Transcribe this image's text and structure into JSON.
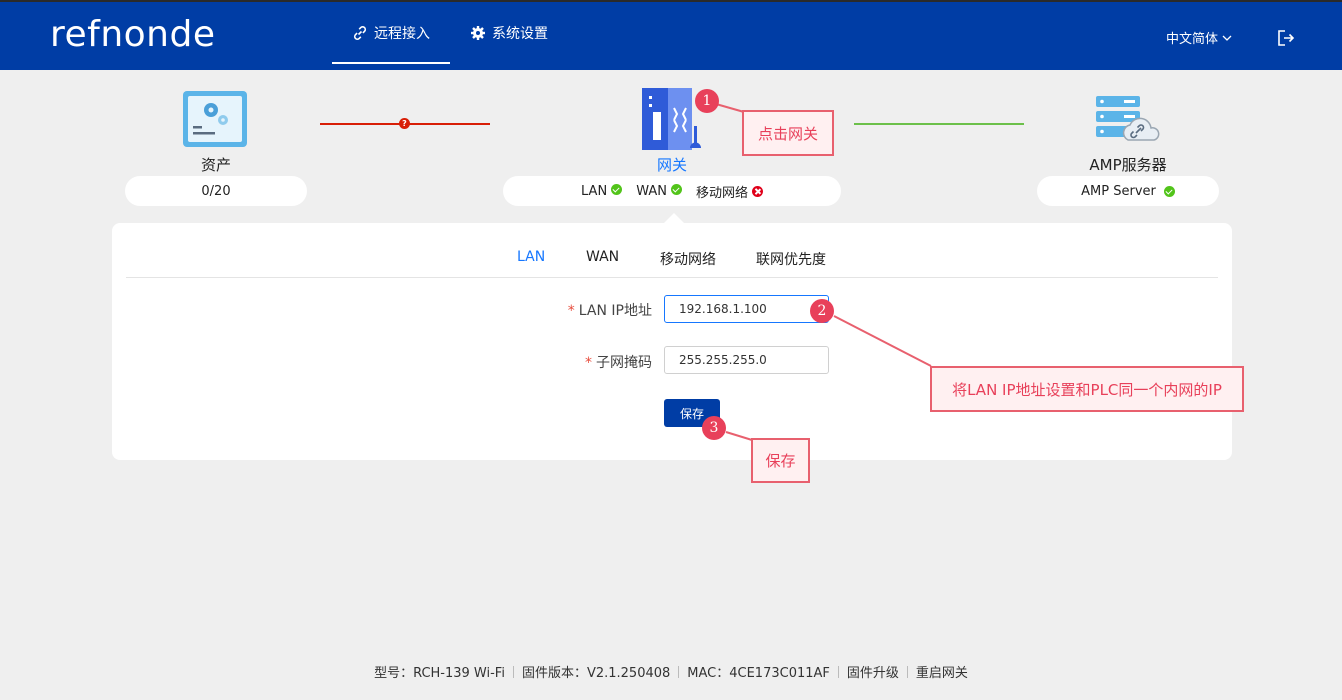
{
  "header": {
    "logo": "refnonde",
    "nav": [
      {
        "label": "远程接入",
        "icon": "link-icon",
        "active": true
      },
      {
        "label": "系统设置",
        "icon": "gear-icon",
        "active": false
      }
    ],
    "language": "中文简体",
    "logout_icon": "logout-icon"
  },
  "topology": {
    "asset": {
      "label": "资产",
      "status": "0/20",
      "icon": "asset-panel-icon"
    },
    "gateway": {
      "label": "网关",
      "icon": "gateway-device-icon",
      "interfaces": [
        {
          "label": "LAN",
          "status": "ok"
        },
        {
          "label": "WAN",
          "status": "ok"
        },
        {
          "label": "移动网络",
          "status": "error"
        }
      ]
    },
    "server": {
      "label": "AMP服务器",
      "status_label": "AMP Server",
      "status": "ok",
      "icon": "server-cloud-icon"
    },
    "links": [
      {
        "from": "asset",
        "to": "gateway",
        "status": "error",
        "color": "#d81e06"
      },
      {
        "from": "gateway",
        "to": "server",
        "status": "ok",
        "color": "#6cc04a"
      }
    ]
  },
  "panel": {
    "tabs": [
      {
        "label": "LAN",
        "active": true
      },
      {
        "label": "WAN",
        "active": false
      },
      {
        "label": "移动网络",
        "active": false
      },
      {
        "label": "联网优先度",
        "active": false
      }
    ],
    "fields": [
      {
        "label": "LAN IP地址",
        "required_mark": "*",
        "value": "192.168.1.100"
      },
      {
        "label": "子网掩码",
        "required_mark": "*",
        "value": "255.255.255.0"
      }
    ],
    "save_label": "保存"
  },
  "annotations": [
    {
      "number": "1",
      "text": "点击网关"
    },
    {
      "number": "2",
      "text": "将LAN IP地址设置和PLC同一个内网的IP"
    },
    {
      "number": "3",
      "text": "保存"
    }
  ],
  "footer": {
    "model": "型号：RCH-139  Wi-Fi",
    "firmware": "固件版本：V2.1.250408",
    "mac": "MAC：4CE173C011AF",
    "upgrade": "固件升级",
    "reboot": "重启网关"
  },
  "colors": {
    "brand": "#003da5",
    "accent": "#1677ff",
    "ok": "#52c41a",
    "error": "#e0001a",
    "annotation": "#e8405a"
  }
}
